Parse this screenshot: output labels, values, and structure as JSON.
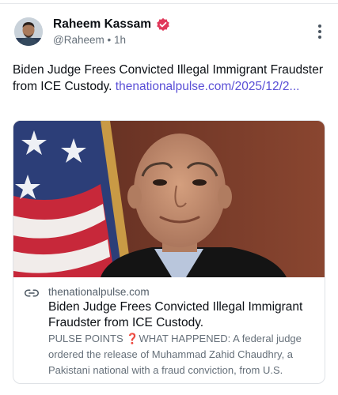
{
  "post": {
    "author_name": "Raheem Kassam",
    "handle": "@Raheem",
    "separator": "•",
    "time": "1h",
    "text": "Biden Judge Frees Convicted Illegal Immigrant Fraudster from ICE Custody.",
    "link_text": "thenationalpulse.com/2025/12/2...",
    "verified_icon": "verified-badge-icon",
    "more_icon": "vertical-ellipsis-icon"
  },
  "card": {
    "image_subject": "judge-portrait",
    "link_icon": "link-icon",
    "domain": "thenationalpulse.com",
    "title": "Biden Judge Frees Convicted Illegal Immigrant Fraudster from ICE Custody.",
    "desc_prefix": "PULSE POINTS",
    "desc_mark": "❓",
    "desc_rest": "WHAT HAPPENED: A federal judge ordered the release of Muhammad Zahid Chaudhry, a Pakistani national with a fraud conviction, from U.S."
  },
  "colors": {
    "link": "#5a4fd6",
    "verified": "#e0385a",
    "muted": "#66707a"
  }
}
